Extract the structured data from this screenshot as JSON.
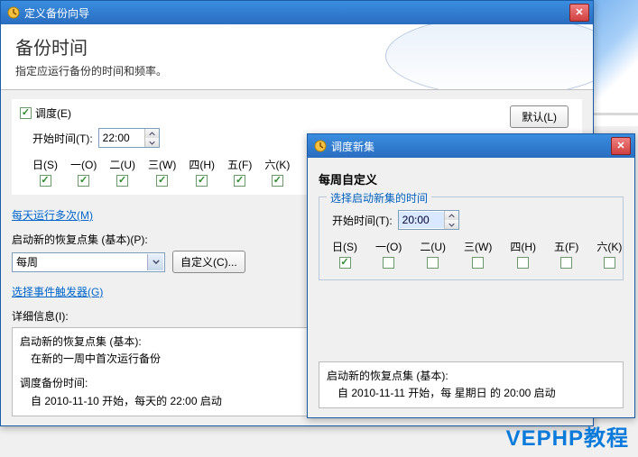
{
  "win1": {
    "title": "定义备份向导",
    "header_title": "备份时间",
    "header_sub": "指定应运行备份的时间和频率。",
    "schedule": {
      "checkbox_label": "调度(E)",
      "checked": true,
      "default_btn": "默认(L)",
      "start_label": "开始时间(T):",
      "start_value": "22:00",
      "days": [
        {
          "label": "日(S)",
          "checked": true
        },
        {
          "label": "一(O)",
          "checked": true
        },
        {
          "label": "二(U)",
          "checked": true
        },
        {
          "label": "三(W)",
          "checked": true
        },
        {
          "label": "四(H)",
          "checked": true
        },
        {
          "label": "五(F)",
          "checked": true
        },
        {
          "label": "六(K)",
          "checked": true
        }
      ]
    },
    "link_multi": "每天运行多次(M)",
    "start_new_label": "启动新的恢复点集 (基本)(P):",
    "select_value": "每周",
    "btn_customize": "自定义(C)...",
    "link_triggers": "选择事件触发器(G)",
    "details_label": "详细信息(I):",
    "details": {
      "line1": "启动新的恢复点集 (基本):",
      "line2": "在新的一周中首次运行备份",
      "line3": "调度备份时间:",
      "line4": "自 2010-11-10 开始，每天的 22:00 启动"
    }
  },
  "win2": {
    "title": "调度新集",
    "header_title": "每周自定义",
    "fieldset_legend": "选择启动新集的时间",
    "start_label": "开始时间(T):",
    "start_value": "20:00",
    "days": [
      {
        "label": "日(S)",
        "checked": true
      },
      {
        "label": "一(O)",
        "checked": false
      },
      {
        "label": "二(U)",
        "checked": false
      },
      {
        "label": "三(W)",
        "checked": false
      },
      {
        "label": "四(H)",
        "checked": false
      },
      {
        "label": "五(F)",
        "checked": false
      },
      {
        "label": "六(K)",
        "checked": false
      }
    ],
    "details": {
      "line1": "启动新的恢复点集 (基本):",
      "line2": "自 2010-11-11 开始，每 星期日 的 20:00 启动"
    }
  },
  "watermark": "VEPHP教程"
}
